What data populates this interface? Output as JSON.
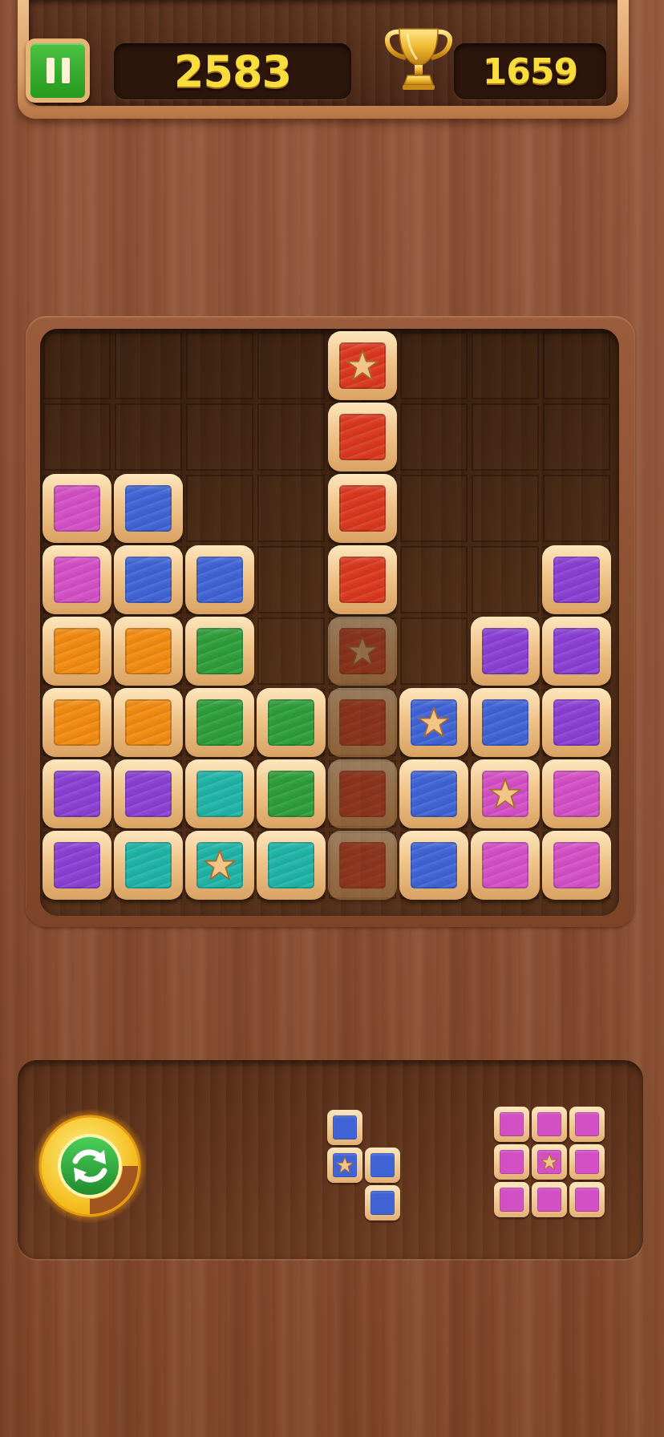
{
  "header": {
    "pause_icon": "pause-icon",
    "score": "2583",
    "best_score": "1659",
    "trophy_icon": "trophy-icon"
  },
  "colors": {
    "pink": "#d24fc4",
    "blue": "#3f63d4",
    "purple": "#8a3fd2",
    "orange": "#f08a10",
    "green": "#2e9d3a",
    "teal": "#1fb3a5",
    "red": "#d9381e"
  },
  "board": {
    "cols": 8,
    "rows": 8,
    "tiles": [
      {
        "row": 0,
        "col": 4,
        "color": "red",
        "star": true
      },
      {
        "row": 1,
        "col": 4,
        "color": "red",
        "star": false
      },
      {
        "row": 2,
        "col": 0,
        "color": "pink",
        "star": false
      },
      {
        "row": 2,
        "col": 1,
        "color": "blue",
        "star": false
      },
      {
        "row": 2,
        "col": 4,
        "color": "red",
        "star": false
      },
      {
        "row": 3,
        "col": 0,
        "color": "pink",
        "star": false
      },
      {
        "row": 3,
        "col": 1,
        "color": "blue",
        "star": false
      },
      {
        "row": 3,
        "col": 2,
        "color": "blue",
        "star": false
      },
      {
        "row": 3,
        "col": 4,
        "color": "red",
        "star": false
      },
      {
        "row": 3,
        "col": 7,
        "color": "purple",
        "star": false
      },
      {
        "row": 4,
        "col": 0,
        "color": "orange",
        "star": false
      },
      {
        "row": 4,
        "col": 1,
        "color": "orange",
        "star": false
      },
      {
        "row": 4,
        "col": 2,
        "color": "green",
        "star": false
      },
      {
        "row": 4,
        "col": 6,
        "color": "purple",
        "star": false
      },
      {
        "row": 4,
        "col": 7,
        "color": "purple",
        "star": false
      },
      {
        "row": 5,
        "col": 0,
        "color": "orange",
        "star": false
      },
      {
        "row": 5,
        "col": 1,
        "color": "orange",
        "star": false
      },
      {
        "row": 5,
        "col": 2,
        "color": "green",
        "star": false
      },
      {
        "row": 5,
        "col": 3,
        "color": "green",
        "star": false
      },
      {
        "row": 5,
        "col": 5,
        "color": "blue",
        "star": true
      },
      {
        "row": 5,
        "col": 6,
        "color": "blue",
        "star": false
      },
      {
        "row": 5,
        "col": 7,
        "color": "purple",
        "star": false
      },
      {
        "row": 6,
        "col": 0,
        "color": "purple",
        "star": false
      },
      {
        "row": 6,
        "col": 1,
        "color": "purple",
        "star": false
      },
      {
        "row": 6,
        "col": 2,
        "color": "teal",
        "star": false
      },
      {
        "row": 6,
        "col": 3,
        "color": "green",
        "star": false
      },
      {
        "row": 6,
        "col": 5,
        "color": "blue",
        "star": false
      },
      {
        "row": 6,
        "col": 6,
        "color": "pink",
        "star": true
      },
      {
        "row": 6,
        "col": 7,
        "color": "pink",
        "star": false
      },
      {
        "row": 7,
        "col": 0,
        "color": "purple",
        "star": false
      },
      {
        "row": 7,
        "col": 1,
        "color": "teal",
        "star": false
      },
      {
        "row": 7,
        "col": 2,
        "color": "teal",
        "star": true
      },
      {
        "row": 7,
        "col": 3,
        "color": "teal",
        "star": false
      },
      {
        "row": 7,
        "col": 5,
        "color": "blue",
        "star": false
      },
      {
        "row": 7,
        "col": 6,
        "color": "pink",
        "star": false
      },
      {
        "row": 7,
        "col": 7,
        "color": "pink",
        "star": false
      }
    ],
    "ghost_tiles": [
      {
        "row": 4,
        "col": 4,
        "color": "red",
        "star": true
      },
      {
        "row": 5,
        "col": 4,
        "color": "red",
        "star": false
      },
      {
        "row": 6,
        "col": 4,
        "color": "red",
        "star": false
      },
      {
        "row": 7,
        "col": 4,
        "color": "red",
        "star": false
      }
    ]
  },
  "tray": {
    "refresh_icon": "refresh-icon",
    "refresh_progress": 0.25,
    "pieces": [
      {
        "name": "s-piece",
        "color": "blue",
        "cells": [
          {
            "row": 0,
            "col": 0,
            "star": false
          },
          {
            "row": 1,
            "col": 0,
            "star": true
          },
          {
            "row": 1,
            "col": 1,
            "star": false
          },
          {
            "row": 2,
            "col": 1,
            "star": false
          }
        ]
      },
      {
        "name": "square-3x3-piece",
        "color": "pink",
        "cells": [
          {
            "row": 0,
            "col": 0,
            "star": false
          },
          {
            "row": 0,
            "col": 1,
            "star": false
          },
          {
            "row": 0,
            "col": 2,
            "star": false
          },
          {
            "row": 1,
            "col": 0,
            "star": false
          },
          {
            "row": 1,
            "col": 1,
            "star": true
          },
          {
            "row": 1,
            "col": 2,
            "star": false
          },
          {
            "row": 2,
            "col": 0,
            "star": false
          },
          {
            "row": 2,
            "col": 1,
            "star": false
          },
          {
            "row": 2,
            "col": 2,
            "star": false
          }
        ]
      }
    ]
  }
}
